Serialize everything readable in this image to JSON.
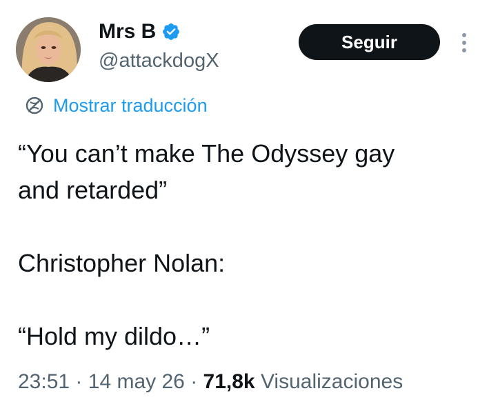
{
  "author": {
    "display_name": "Mrs B",
    "handle": "@attackdogX",
    "verified": true,
    "verified_color": "#1d9bf0"
  },
  "actions": {
    "follow_label": "Seguir",
    "more_icon": "more-vertical-icon"
  },
  "translate": {
    "label": "Mostrar traducción",
    "icon": "globe-icon",
    "color": "#1d9bf0"
  },
  "tweet": {
    "lines": [
      "“You can’t make The Odyssey gay",
      "and retarded”",
      "",
      "Christopher Nolan:",
      "",
      "“Hold my dildo…”"
    ]
  },
  "meta": {
    "time": "23:51",
    "separator": "·",
    "date": "14 may 26",
    "views_count": "71,8k",
    "views_label": "Visualizaciones"
  },
  "colors": {
    "text_primary": "#0f1419",
    "text_secondary": "#536471",
    "button_bg": "#0f1419",
    "button_text": "#ffffff"
  }
}
